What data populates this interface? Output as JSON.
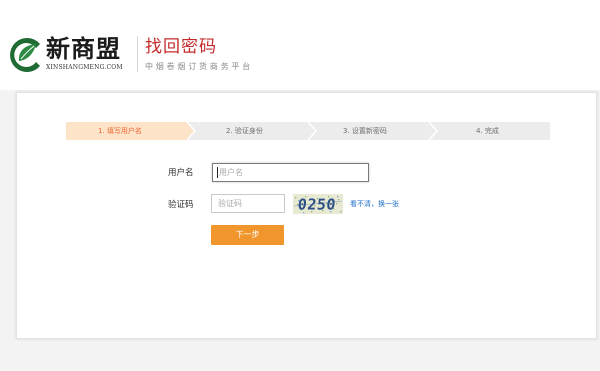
{
  "header": {
    "logo": {
      "name": "新商盟",
      "subtitle": "XINSHANGMENG.COM",
      "brand_color": "#1f6b33"
    },
    "page_title": "找回密码",
    "page_subtitle": "中烟卷烟订货商务平台"
  },
  "steps": {
    "current": 1,
    "active_color": "#fde3c7",
    "inactive_color": "#ececec",
    "items": [
      {
        "label": "1. 填写用户名"
      },
      {
        "label": "2. 验证身份"
      },
      {
        "label": "3. 设置新密码"
      },
      {
        "label": "4. 完成"
      }
    ]
  },
  "form": {
    "username": {
      "label": "用户名",
      "value": "",
      "placeholder": "用户名"
    },
    "captcha": {
      "label": "验证码",
      "value": "",
      "placeholder": "验证码",
      "image_text": "0250",
      "refresh_link": "看不清，换一张"
    },
    "next_button": "下一步",
    "button_color": "#f0962c"
  }
}
